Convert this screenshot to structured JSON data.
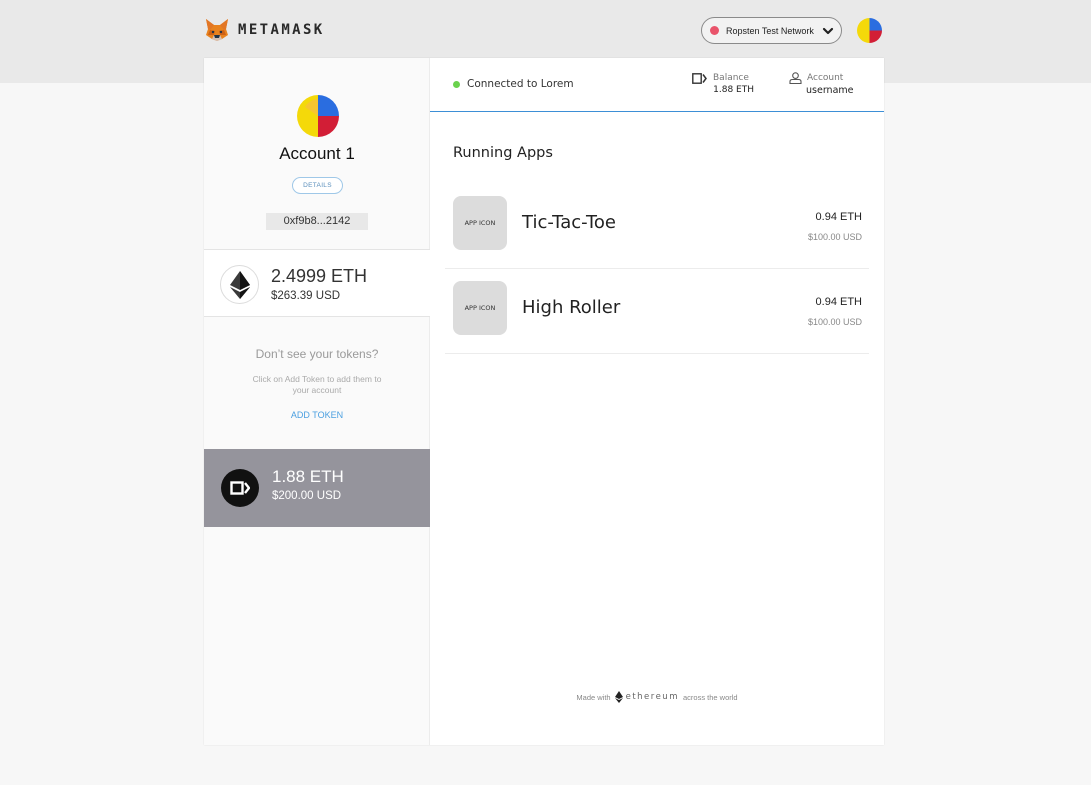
{
  "app": {
    "title": "METAMASK"
  },
  "network": {
    "name": "Ropsten Test Network",
    "status_color": "#e9546b"
  },
  "sidebar": {
    "account_name": "Account 1",
    "details_label": "DETAILS",
    "address": "0xf9b8...2142",
    "eth_balance": {
      "amount": "2.4999 ETH",
      "usd": "$263.39 USD"
    },
    "tokens": {
      "title": "Don’t see your tokens?",
      "description": "Click on Add Token to add them to your account",
      "add_label": "ADD TOKEN"
    },
    "active_balance": {
      "amount": "1.88 ETH",
      "usd": "$200.00 USD"
    }
  },
  "main": {
    "connection": {
      "text": "Connected to Lorem",
      "status_color": "#6ad24d"
    },
    "balance": {
      "label": "Balance",
      "value": "1.88 ETH"
    },
    "account": {
      "label": "Account",
      "value": "username"
    },
    "apps_title": "Running Apps",
    "apps": [
      {
        "icon_text": "APP ICON",
        "name": "Tic-Tac-Toe",
        "eth": "0.94 ETH",
        "usd": "$100.00 USD"
      },
      {
        "icon_text": "APP ICON",
        "name": "High Roller",
        "eth": "0.94 ETH",
        "usd": "$100.00 USD"
      }
    ],
    "footer": {
      "prefix": "Made with",
      "brand": "ethereum",
      "suffix": "across the world"
    }
  },
  "colors": {
    "accent": "#3d8fd6",
    "link": "#4a9fe0",
    "active_row": "#95949c"
  },
  "icons": [
    "metamask-fox-icon",
    "chevron-down-icon",
    "account-avatar-icon",
    "ethereum-icon",
    "wallet-icon",
    "user-icon"
  ]
}
